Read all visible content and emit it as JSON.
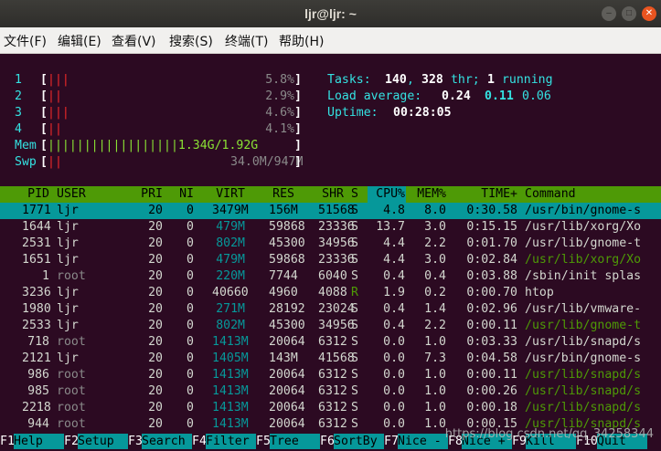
{
  "window": {
    "title": "ljr@ljr: ~"
  },
  "menu": [
    "文件(F)",
    "编辑(E)",
    "查看(V)",
    "搜索(S)",
    "终端(T)",
    "帮助(H)"
  ],
  "meters": [
    {
      "label": "1",
      "bar": "|||",
      "value": "5.8%"
    },
    {
      "label": "2",
      "bar": "||",
      "value": "2.9%"
    },
    {
      "label": "3",
      "bar": "|||",
      "value": "4.6%"
    },
    {
      "label": "4",
      "bar": "||",
      "value": "4.1%"
    },
    {
      "label": "Mem",
      "bar": "||||||||||||||||||1.34G/1.92G",
      "value": ""
    },
    {
      "label": "Swp",
      "bar": "||",
      "value": "34.0M/947M"
    }
  ],
  "summary": {
    "tasks_label": "Tasks: ",
    "tasks": "140",
    "sep1": ", ",
    "threads": "328",
    "thr_label": " thr; ",
    "running": "1",
    "running_label": " running",
    "load_label": "Load average: ",
    "load1": "0.24",
    "load5": "0.11",
    "load15": "0.06",
    "uptime_label": "Uptime: ",
    "uptime": "00:28:05"
  },
  "columns": [
    "PID",
    "USER",
    "PRI",
    "NI",
    "VIRT",
    "RES",
    "SHR",
    "S",
    "CPU%",
    "MEM%",
    "TIME+",
    "Command"
  ],
  "processes": [
    [
      "1771",
      "ljr",
      "20",
      "0",
      "3479M",
      "156M",
      "51568",
      "S",
      "4.8",
      "8.0",
      "0:30.58",
      "/usr/bin/gnome-s"
    ],
    [
      "1644",
      "ljr",
      "20",
      "0",
      "479M",
      "59868",
      "23336",
      "S",
      "13.7",
      "3.0",
      "0:15.15",
      "/usr/lib/xorg/Xo"
    ],
    [
      "2531",
      "ljr",
      "20",
      "0",
      "802M",
      "45300",
      "34956",
      "S",
      "4.4",
      "2.2",
      "0:01.70",
      "/usr/lib/gnome-t"
    ],
    [
      "1651",
      "ljr",
      "20",
      "0",
      "479M",
      "59868",
      "23336",
      "S",
      "4.4",
      "3.0",
      "0:02.84",
      "/usr/lib/xorg/Xo"
    ],
    [
      "1",
      "root",
      "20",
      "0",
      "220M",
      "7744",
      "6040",
      "S",
      "0.4",
      "0.4",
      "0:03.88",
      "/sbin/init splas"
    ],
    [
      "3236",
      "ljr",
      "20",
      "0",
      "40660",
      "4960",
      "4088",
      "R",
      "1.9",
      "0.2",
      "0:00.70",
      "htop"
    ],
    [
      "1980",
      "ljr",
      "20",
      "0",
      "271M",
      "28192",
      "23024",
      "S",
      "0.4",
      "1.4",
      "0:02.96",
      "/usr/lib/vmware-"
    ],
    [
      "2533",
      "ljr",
      "20",
      "0",
      "802M",
      "45300",
      "34956",
      "S",
      "0.4",
      "2.2",
      "0:00.11",
      "/usr/lib/gnome-t"
    ],
    [
      "718",
      "root",
      "20",
      "0",
      "1413M",
      "20064",
      "6312",
      "S",
      "0.0",
      "1.0",
      "0:03.33",
      "/usr/lib/snapd/s"
    ],
    [
      "2121",
      "ljr",
      "20",
      "0",
      "1405M",
      "143M",
      "41568",
      "S",
      "0.0",
      "7.3",
      "0:04.58",
      "/usr/bin/gnome-s"
    ],
    [
      "986",
      "root",
      "20",
      "0",
      "1413M",
      "20064",
      "6312",
      "S",
      "0.0",
      "1.0",
      "0:00.11",
      "/usr/lib/snapd/s"
    ],
    [
      "985",
      "root",
      "20",
      "0",
      "1413M",
      "20064",
      "6312",
      "S",
      "0.0",
      "1.0",
      "0:00.26",
      "/usr/lib/snapd/s"
    ],
    [
      "2218",
      "root",
      "20",
      "0",
      "1413M",
      "20064",
      "6312",
      "S",
      "0.0",
      "1.0",
      "0:00.18",
      "/usr/lib/snapd/s"
    ],
    [
      "944",
      "root",
      "20",
      "0",
      "1413M",
      "20064",
      "6312",
      "S",
      "0.0",
      "1.0",
      "0:00.15",
      "/usr/lib/snapd/s"
    ]
  ],
  "fkeys": [
    {
      "key": "F1",
      "label": "Help  "
    },
    {
      "key": "F2",
      "label": "Setup "
    },
    {
      "key": "F3",
      "label": "Search"
    },
    {
      "key": "F4",
      "label": "Filter"
    },
    {
      "key": "F5",
      "label": "Tree  "
    },
    {
      "key": "F6",
      "label": "SortBy"
    },
    {
      "key": "F7",
      "label": "Nice -"
    },
    {
      "key": "F8",
      "label": "Nice +"
    },
    {
      "key": "F9",
      "label": "Kill  "
    },
    {
      "key": "F10",
      "label": "Quit  "
    }
  ],
  "watermark": "https://blog.csdn.net/qq_34258344",
  "colors": {
    "accent": "#06989a",
    "header": "#4e9a06",
    "background": "#2c0a22"
  }
}
